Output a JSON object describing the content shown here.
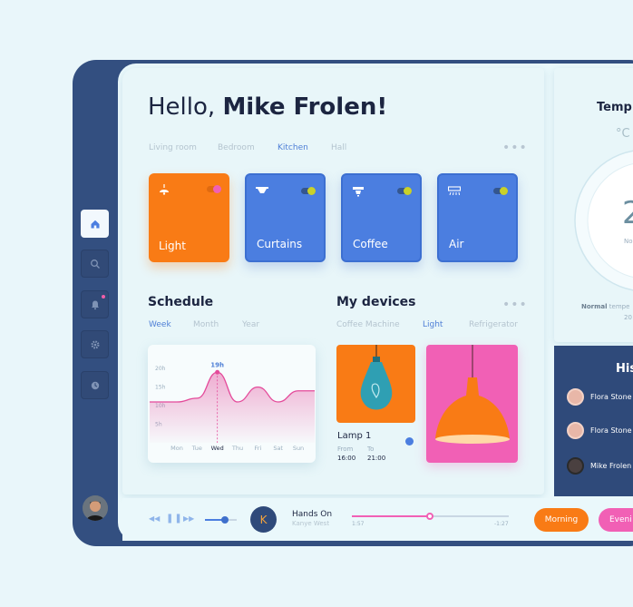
{
  "greeting": {
    "hello": "Hello,",
    "name": "Mike Frolen!"
  },
  "rooms": [
    "Living room",
    "Bedroom",
    "Kitchen",
    "Hall"
  ],
  "active_room": "Kitchen",
  "tiles": [
    {
      "label": "Light",
      "icon": "ceiling-lamp-icon",
      "on": true
    },
    {
      "label": "Curtains",
      "icon": "curtains-icon",
      "on": true
    },
    {
      "label": "Coffee",
      "icon": "coffee-machine-icon",
      "on": true
    },
    {
      "label": "Air",
      "icon": "air-conditioner-icon",
      "on": true
    }
  ],
  "schedule": {
    "title": "Schedule",
    "tabs": [
      "Week",
      "Month",
      "Year"
    ],
    "active_tab": "Week"
  },
  "chart_data": {
    "type": "area",
    "categories": [
      "Mon",
      "Tue",
      "Wed",
      "Thu",
      "Fri",
      "Sat",
      "Sun"
    ],
    "values": [
      11,
      12,
      19,
      11,
      15,
      11,
      14
    ],
    "yticks": [
      "20h",
      "15h",
      "10h",
      "5h"
    ],
    "ylim": [
      0,
      22
    ],
    "highlight": {
      "category": "Wed",
      "label": "19h"
    },
    "color": "#e44a9a"
  },
  "devices": {
    "title": "My devices",
    "tabs": [
      "Coffee Machine",
      "Light",
      "Refrigerator"
    ],
    "active_tab": "Light",
    "lamp": {
      "name": "Lamp 1",
      "from_label": "From",
      "to_label": "To",
      "from": "16:00",
      "to": "21:00"
    }
  },
  "temperature": {
    "title": "Temp",
    "unit": "°C",
    "value": "2",
    "status_prefix": "No",
    "note_bold": "Normal",
    "note_rest": "tempe",
    "note_line2": "20"
  },
  "history": {
    "title": "His",
    "people": [
      "Flora Stone",
      "Flora Stone",
      "Mike Frolen"
    ]
  },
  "player": {
    "title": "Hands On",
    "artist": "Kanye West",
    "disc_letter": "K",
    "elapsed": "1:57",
    "remaining": "-1:27",
    "progress": 0.5,
    "volume": 0.63
  },
  "scenes": [
    "Morning",
    "Eveni"
  ],
  "colors": {
    "navy": "#334f80",
    "orange": "#f97b15",
    "blue": "#4b7ee0",
    "pink": "#f160b5",
    "accent_text": "#4f7fd6"
  }
}
